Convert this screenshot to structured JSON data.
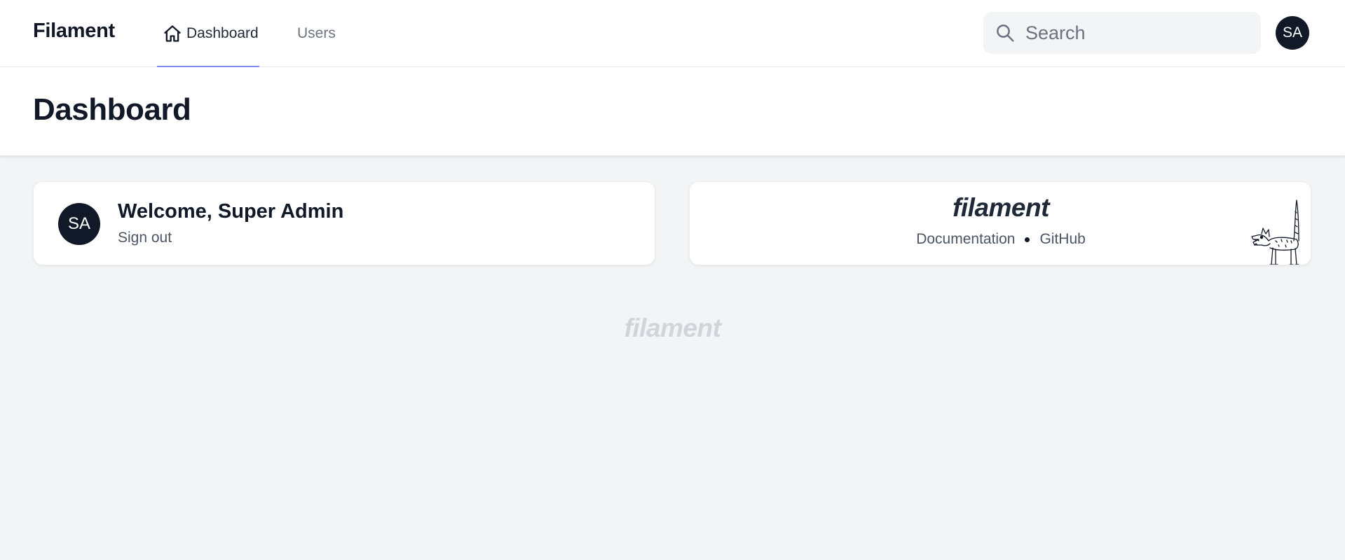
{
  "brand": "Filament",
  "nav": {
    "tabs": [
      {
        "label": "Dashboard",
        "icon": "home-icon",
        "active": true
      },
      {
        "label": "Users",
        "active": false
      }
    ]
  },
  "search": {
    "placeholder": "Search",
    "value": ""
  },
  "user": {
    "initials": "SA"
  },
  "page": {
    "title": "Dashboard"
  },
  "account_widget": {
    "initials": "SA",
    "welcome": "Welcome, Super Admin",
    "signout": "Sign out"
  },
  "info_widget": {
    "logo": "filament",
    "links": [
      "Documentation",
      "GitHub"
    ]
  },
  "footer": {
    "logo": "filament"
  },
  "colors": {
    "accent": "#818cf8",
    "dark": "#111827",
    "background": "#f3f4f6",
    "muted_logo": "#d1d5db"
  }
}
